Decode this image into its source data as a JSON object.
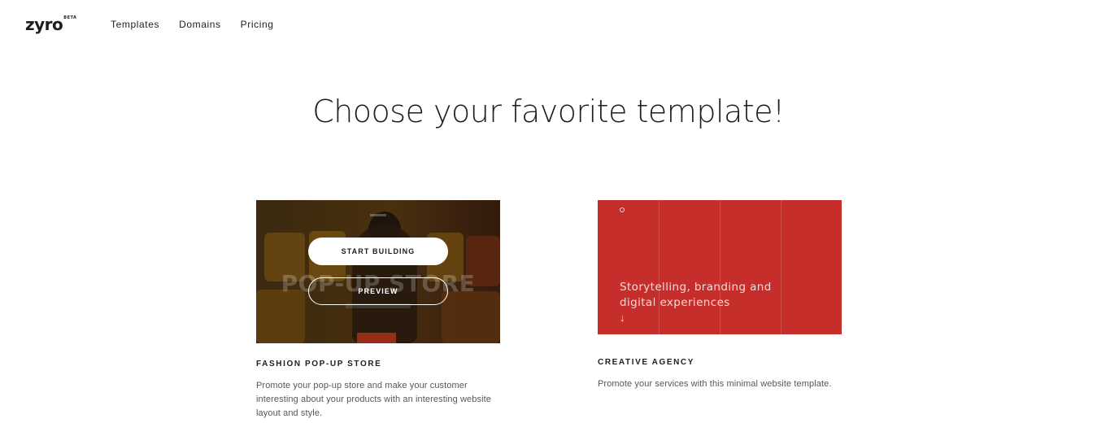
{
  "header": {
    "logo": "zyro",
    "beta": "BETA",
    "nav": [
      "Templates",
      "Domains",
      "Pricing"
    ]
  },
  "page": {
    "title": "Choose your favorite template!"
  },
  "templates": [
    {
      "name": "FASHION POP-UP STORE",
      "description": "Promote your pop-up store and make your customer interesting about your products with an interesting website layout and style.",
      "thumbnail_title": "POP-UP STORE",
      "start_label": "START BUILDING",
      "preview_label": "PREVIEW"
    },
    {
      "name": "CREATIVE AGENCY",
      "description": "Promote your services with this minimal website template.",
      "thumbnail_tagline": "Storytelling, branding and digital experiences",
      "thumbnail_arrow": "↓",
      "accent_color": "#c62e2b"
    }
  ]
}
